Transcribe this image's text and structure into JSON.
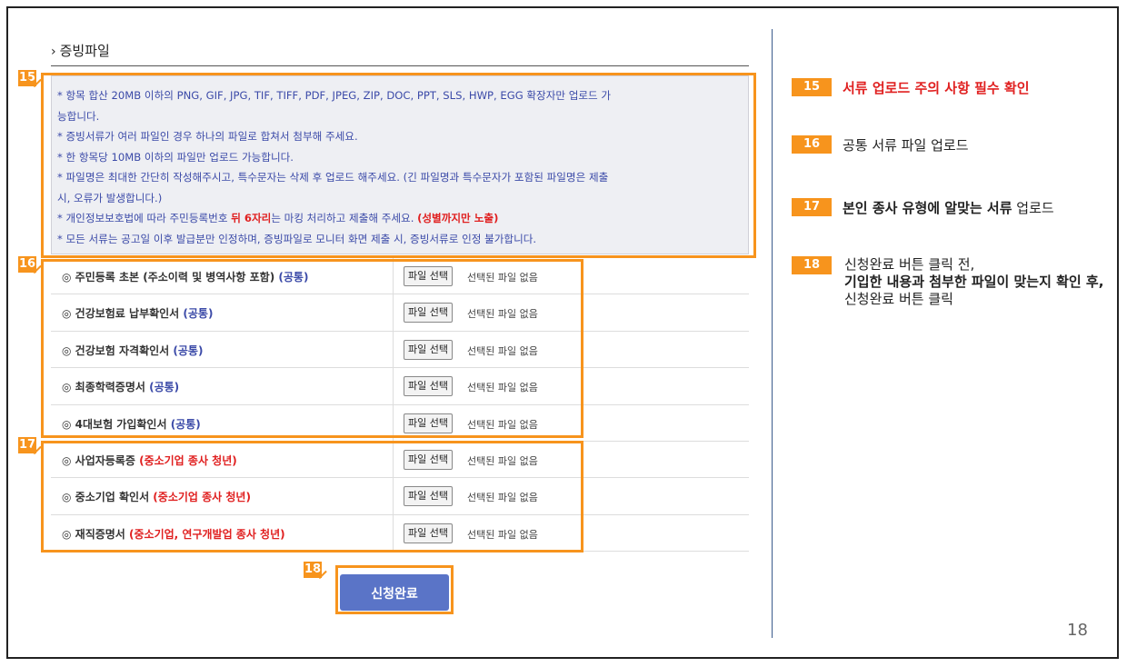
{
  "section_title": "증빙파일",
  "notice": {
    "line1": "* 항목 합산 20MB 이하의 PNG, GIF, JPG, TIF, TIFF, PDF, JPEG, ZIP, DOC, PPT, SLS, HWP, EGG 확장자만 업로드 가",
    "line1b": "능합니다.",
    "line2": "* 증빙서류가 여러 파일인 경우 하나의 파일로 합쳐서 첨부해 주세요.",
    "line3": "* 한 항목당 10MB 이하의 파일만 업로드 가능합니다.",
    "line4": "* 파일명은 최대한 간단히 작성해주시고, 특수문자는 삭제 후 업로드 해주세요. (긴 파일명과 특수문자가 포함된 파일명은 제출",
    "line4b": "시, 오류가 발생합니다.)",
    "line5a": "* 개인정보보호법에 따라 주민등록번호 ",
    "line5b": "뒤 6자리",
    "line5c": "는 마킹 처리하고 제출해 주세요. ",
    "line5d": "(성별까지만 노출)",
    "line6": "* 모든 서류는 공고일 이후 발급분만 인정하며, 증빙파일로 모니터 화면 제출 시, 증빙서류로 인정 불가합니다."
  },
  "rows": [
    {
      "label": "◎ 주민등록 초본 (주소이력 및 병역사항 포함) ",
      "tag": "(공통)",
      "tag_color": "blue"
    },
    {
      "label": "◎ 건강보험료 납부확인서 ",
      "tag": "(공통)",
      "tag_color": "blue"
    },
    {
      "label": "◎ 건강보험 자격확인서 ",
      "tag": "(공통)",
      "tag_color": "blue"
    },
    {
      "label": "◎ 최종학력증명서 ",
      "tag": "(공통)",
      "tag_color": "blue"
    },
    {
      "label": "◎ 4대보험 가입확인서 ",
      "tag": "(공통)",
      "tag_color": "blue"
    },
    {
      "label": "◎ 사업자등록증 ",
      "tag": "(중소기업 종사 청년)",
      "tag_color": "red"
    },
    {
      "label": "◎ 중소기업 확인서 ",
      "tag": "(중소기업 종사 청년)",
      "tag_color": "red"
    },
    {
      "label": "◎ 재직증명서 ",
      "tag": "(중소기업, 연구개발업 종사 청년)",
      "tag_color": "red"
    }
  ],
  "file_button_label": "파일 선택",
  "file_status": "선택된 파일 없음",
  "submit_label": "신청완료",
  "badges": {
    "b15": "15",
    "b16": "16",
    "b17": "17",
    "b18": "18"
  },
  "legend": {
    "l15": "서류 업로드 주의 사항 필수 확인",
    "l16": "공통 서류 파일 업로드",
    "l17_bold": "본인 종사 유형에 알맞는 서류",
    "l17_rest": " 업로드",
    "l18_line1": "신청완료 버튼 클릭 전,",
    "l18_bold": "기입한 내용과 첨부한 파일이 맞는지 확인 후,",
    "l18_rest": " 신청완료 버튼 클릭"
  },
  "page_number": "18",
  "colors": {
    "accent": "#f7941d",
    "notice_text": "#3b4aa8",
    "warning": "#e02020",
    "submit": "#5a74c7"
  }
}
